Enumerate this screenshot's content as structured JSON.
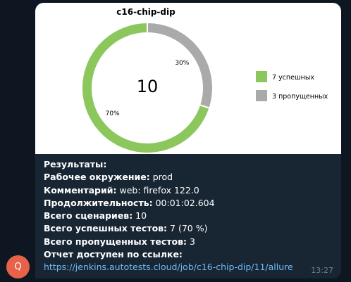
{
  "avatar": {
    "letter": "Q",
    "color": "#e8624a"
  },
  "message": {
    "lines": [
      {
        "key": "Результаты:",
        "value": ""
      },
      {
        "key": "Рабочее окружение:",
        "value": " prod"
      },
      {
        "key": "Комментарий:",
        "value": " web: firefox 122.0"
      },
      {
        "key": "Продолжительность:",
        "value": " 00:01:02.604"
      },
      {
        "key": "Всего сценариев:",
        "value": " 10"
      },
      {
        "key": "Всего успешных тестов:",
        "value": " 7 (70 %)"
      },
      {
        "key": "Всего пропущенных тестов:",
        "value": " 3"
      },
      {
        "key": "Отчет доступен по ссылке:",
        "value": ""
      }
    ],
    "link": "https://jenkins.autotests.cloud/job/c16-chip-dip/11/allure",
    "time": "13:27"
  },
  "chart_data": {
    "type": "pie",
    "title": "c16-chip-dip",
    "center_label": "10",
    "slices": [
      {
        "label": "7 успешных",
        "value": 7,
        "percent_label": "70%",
        "color": "#8cc75e"
      },
      {
        "label": "3 пропущенных",
        "value": 3,
        "percent_label": "30%",
        "color": "#aaaaaa"
      }
    ],
    "legend_position": "right"
  }
}
